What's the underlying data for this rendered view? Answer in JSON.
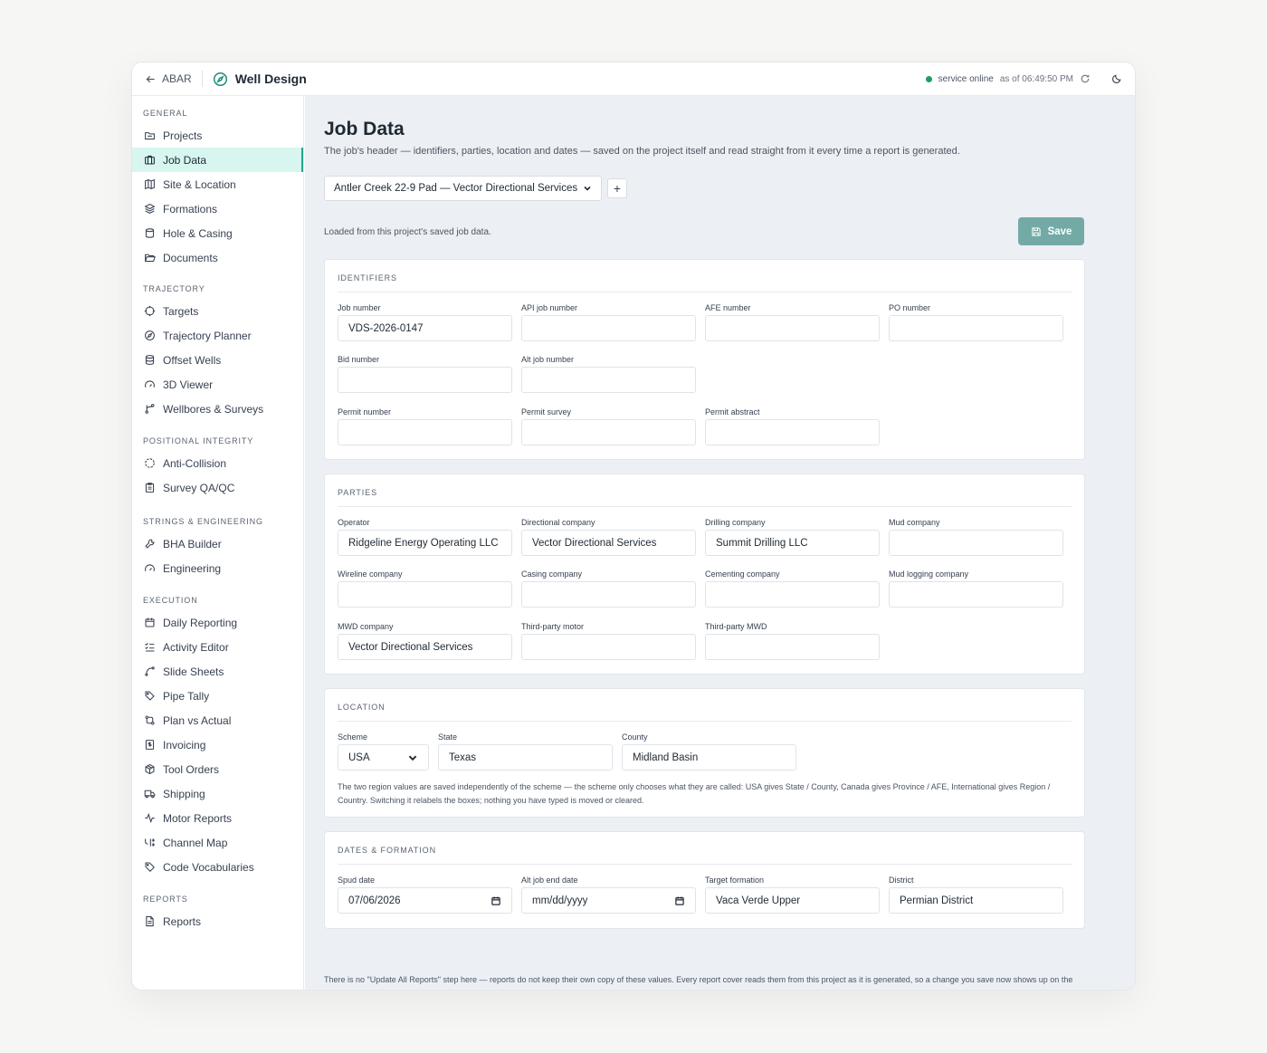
{
  "topbar": {
    "back_label": "ABAR",
    "app_title": "Well Design",
    "status_text": "service online",
    "as_of": "as of 06:49:50 PM",
    "status_color": "#1f9d63"
  },
  "sidebar": {
    "groups": [
      {
        "label": "GENERAL",
        "items": [
          {
            "label": "Projects",
            "icon": "folder-icon"
          },
          {
            "label": "Job Data",
            "icon": "briefcase-icon",
            "active": true
          },
          {
            "label": "Site & Location",
            "icon": "map-icon"
          },
          {
            "label": "Formations",
            "icon": "layers-icon"
          },
          {
            "label": "Hole & Casing",
            "icon": "cylinder-icon"
          },
          {
            "label": "Documents",
            "icon": "folder-open-icon"
          }
        ]
      },
      {
        "label": "TRAJECTORY",
        "items": [
          {
            "label": "Targets",
            "icon": "target-icon"
          },
          {
            "label": "Trajectory Planner",
            "icon": "compass-icon"
          },
          {
            "label": "Offset Wells",
            "icon": "database-icon"
          },
          {
            "label": "3D Viewer",
            "icon": "gauge-icon"
          },
          {
            "label": "Wellbores & Surveys",
            "icon": "branch-icon"
          }
        ]
      },
      {
        "label": "POSITIONAL INTEGRITY",
        "items": [
          {
            "label": "Anti-Collision",
            "icon": "circle-dashed-icon"
          },
          {
            "label": "Survey QA/QC",
            "icon": "clipboard-icon"
          }
        ]
      },
      {
        "label": "STRINGS & ENGINEERING",
        "items": [
          {
            "label": "BHA Builder",
            "icon": "wrench-icon"
          },
          {
            "label": "Engineering",
            "icon": "gauge-icon"
          }
        ]
      },
      {
        "label": "EXECUTION",
        "items": [
          {
            "label": "Daily Reporting",
            "icon": "calendar-icon"
          },
          {
            "label": "Activity Editor",
            "icon": "list-check-icon"
          },
          {
            "label": "Slide Sheets",
            "icon": "curve-icon"
          },
          {
            "label": "Pipe Tally",
            "icon": "tag-icon"
          },
          {
            "label": "Plan vs Actual",
            "icon": "arrows-compare-icon"
          },
          {
            "label": "Invoicing",
            "icon": "receipt-icon"
          },
          {
            "label": "Tool Orders",
            "icon": "package-icon"
          },
          {
            "label": "Shipping",
            "icon": "truck-icon"
          },
          {
            "label": "Motor Reports",
            "icon": "activity-icon"
          },
          {
            "label": "Channel Map",
            "icon": "channel-icon"
          },
          {
            "label": "Code Vocabularies",
            "icon": "tag-icon"
          }
        ]
      },
      {
        "label": "REPORTS",
        "items": [
          {
            "label": "Reports",
            "icon": "file-text-icon"
          }
        ]
      }
    ]
  },
  "main": {
    "title": "Job Data",
    "subtitle": "The job's header — identifiers, parties, location and dates — saved on the project itself and read straight from it every time a report is generated.",
    "job_select_value": "Antler Creek 22-9 Pad — Vector Directional Services",
    "add_label": "+",
    "loaded_note": "Loaded from this project's saved job data.",
    "save_label": "Save",
    "save_color": "#73aaa6",
    "identifiers": {
      "title": "IDENTIFIERS",
      "fields": [
        {
          "label": "Job number",
          "value": "VDS-2026-0147"
        },
        {
          "label": "API job number",
          "value": ""
        },
        {
          "label": "AFE number",
          "value": ""
        },
        {
          "label": "PO number",
          "value": ""
        },
        {
          "label": "Bid number",
          "value": ""
        },
        {
          "label": "Alt job number",
          "value": ""
        },
        {
          "label": "Permit number",
          "value": ""
        },
        {
          "label": "Permit survey",
          "value": ""
        },
        {
          "label": "Permit abstract",
          "value": ""
        }
      ]
    },
    "parties": {
      "title": "PARTIES",
      "fields": [
        {
          "label": "Operator",
          "value": "Ridgeline Energy Operating LLC"
        },
        {
          "label": "Directional company",
          "value": "Vector Directional Services"
        },
        {
          "label": "Drilling company",
          "value": "Summit Drilling LLC"
        },
        {
          "label": "Mud company",
          "value": ""
        },
        {
          "label": "Wireline company",
          "value": ""
        },
        {
          "label": "Casing company",
          "value": ""
        },
        {
          "label": "Cementing company",
          "value": ""
        },
        {
          "label": "Mud logging company",
          "value": ""
        },
        {
          "label": "MWD company",
          "value": "Vector Directional Services"
        },
        {
          "label": "Third-party motor",
          "value": ""
        },
        {
          "label": "Third-party MWD",
          "value": ""
        }
      ]
    },
    "location": {
      "title": "LOCATION",
      "scheme_label": "Scheme",
      "scheme_value": "USA",
      "state_label": "State",
      "state_value": "Texas",
      "county_label": "County",
      "county_value": "Midland Basin",
      "note": "The two region values are saved independently of the scheme — the scheme only chooses what they are called: USA gives State / County, Canada gives Province / AFE, International gives Region / Country. Switching it relabels the boxes; nothing you have typed is moved or cleared."
    },
    "dates": {
      "title": "DATES & FORMATION",
      "fields": [
        {
          "label": "Spud date",
          "value": "07/06/2026"
        },
        {
          "label": "Alt job end date",
          "value": "mm/dd/yyyy"
        },
        {
          "label": "Target formation",
          "value": "Vaca Verde Upper"
        },
        {
          "label": "District",
          "value": "Permian District"
        }
      ]
    },
    "footer_note": "There is no \"Update All Reports\" step here — reports do not keep their own copy of these values. Every report cover reads them from this project as it is generated, so a change you save now shows up on the next report you generate."
  }
}
